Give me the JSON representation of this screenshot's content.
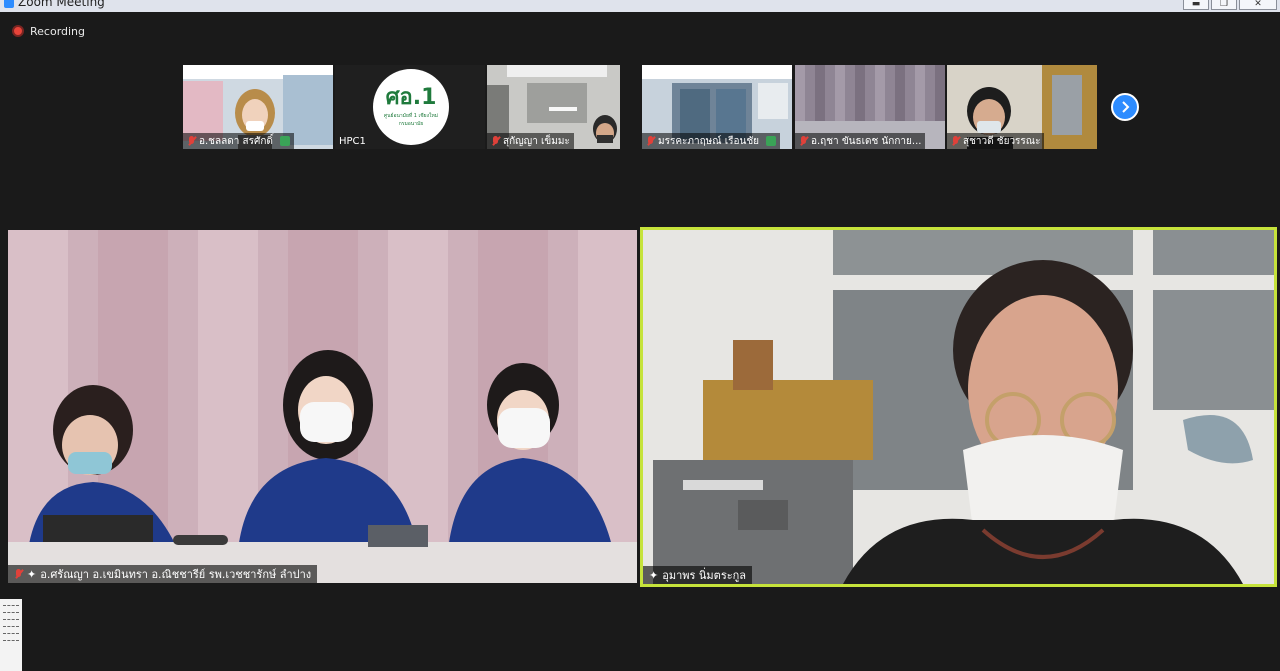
{
  "window": {
    "title": "Zoom Meeting",
    "controls": [
      "minimize",
      "restore",
      "close"
    ]
  },
  "recording": {
    "label": "Recording"
  },
  "thumbnails": [
    {
      "name": "อ.ชลลดา สรศักดิ์",
      "muted": true
    },
    {
      "name": "HPC1",
      "muted": false,
      "logo_text": "ศอ.1",
      "logo_subtitle": "ศูนย์อนามัยที่ 1 เชียงใหม่",
      "logo_caption": "กรมอนามัย"
    },
    {
      "name": "สุกัญญา เข็มมะ",
      "muted": true
    },
    {
      "name": "มรรคะภาฤษณ์ เรือนชัย",
      "muted": true
    },
    {
      "name": "อ.ฤชา ขันธเดช นักกาย...",
      "muted": true
    },
    {
      "name": "สุชาวดี ชัยวรรณะ",
      "muted": true
    }
  ],
  "main_tiles": [
    {
      "name": "อ.ศรัณญา อ.เขมินทรา อ.ณิชชารีย์ รพ.เวชชารักษ์ ลำปาง",
      "muted": true,
      "active_speaker": false
    },
    {
      "name": "อุมาพร นิ่มตระกูล",
      "muted": false,
      "active_speaker": true
    }
  ],
  "colors": {
    "accent": "#2d8cff",
    "active_speaker_border": "#c6e33b",
    "muted": "#e0413a",
    "background": "#1a1a1a"
  }
}
